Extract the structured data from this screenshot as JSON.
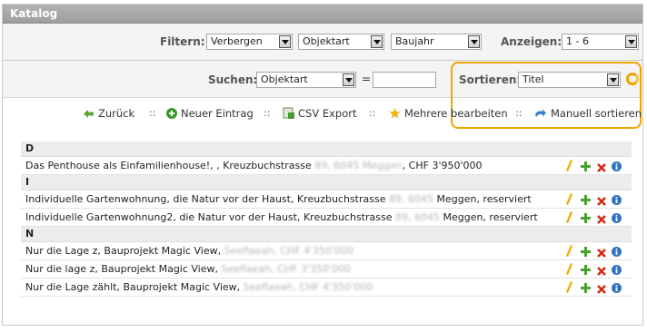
{
  "panel": {
    "title": "Katalog"
  },
  "filters": {
    "label": "Filtern:",
    "filter1": "Verbergen",
    "filter2": "Objektart",
    "filter3": "Baujahr",
    "display_label": "Anzeigen:",
    "display_value": "1 - 6"
  },
  "search": {
    "label": "Suchen:",
    "field": "Objektart",
    "equals": "=",
    "value": ""
  },
  "sort": {
    "label": "Sortieren:",
    "value": "Titel"
  },
  "actions": {
    "back": "Zurück",
    "new_entry": "Neuer Eintrag",
    "csv_export": "CSV Export",
    "bulk_edit": "Mehrere bearbeiten",
    "manual_sort": "Manuell sortieren",
    "separator": "::"
  },
  "groups": [
    {
      "letter": "D",
      "items": [
        {
          "pre": "Das Penthouse als Einfamilienhouse!, , Kreuzbuchstrasse ",
          "blur": "89, 6045 Meggen",
          "post": ", CHF 3'950'000"
        }
      ]
    },
    {
      "letter": "I",
      "items": [
        {
          "pre": "Individuelle Gartenwohnung, die Natur vor der Haust, Kreuzbuchstrasse ",
          "blur": "89, 6045",
          "post": " Meggen, reserviert"
        },
        {
          "pre": "Individuelle Gartenwohnung2, die Natur vor der Haust, Kreuzbuchstrasse ",
          "blur": "89, 6045",
          "post": " Meggen, reserviert"
        }
      ]
    },
    {
      "letter": "N",
      "items": [
        {
          "pre": "Nur die Lage z, Bauprojekt Magic View, ",
          "blur": "Seeflaeah, CHF 4'350'000",
          "post": ""
        },
        {
          "pre": "Nur die lage z, Bauprojekt Magic View, ",
          "blur": "Seeflaeah, CHF 3'350'000",
          "post": ""
        },
        {
          "pre": "Nur die Lage zählt, Bauprojekt Magic View, ",
          "blur": "Seeflaeah, CHF 4'350'000",
          "post": ""
        }
      ]
    }
  ]
}
